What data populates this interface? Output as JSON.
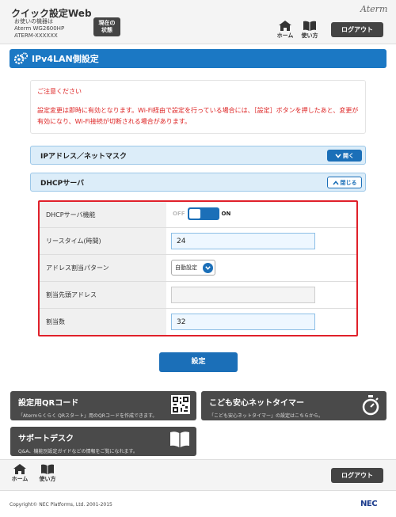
{
  "header": {
    "app_title": "クイック設定Web",
    "device_label": "お使いの機器は",
    "device_model": "Aterm WG2600HP",
    "device_id": "ATERM-XXXXXX",
    "current_status_line1": "現在の",
    "current_status_line2": "状態",
    "brand": "Aterm",
    "home_label": "ホーム",
    "help_label": "使い方",
    "logout_label": "ログアウト"
  },
  "page": {
    "title": "IPv4LAN側設定"
  },
  "notice": {
    "title": "ご注意ください",
    "body": "設定変更は即時に有効となります。Wi-Fi経由で設定を行っている場合には、［設定］ボタンを押したあと、変更が有効になり、Wi-Fi接続が切断される場合があります。"
  },
  "sections": {
    "ip_mask": {
      "label": "IPアドレス／ネットマスク",
      "button": "開く"
    },
    "dhcp": {
      "label": "DHCPサーバ",
      "button": "閉じる"
    }
  },
  "dhcp_settings": {
    "rows": [
      {
        "label": "DHCPサーバ機能",
        "off_label": "OFF",
        "on_label": "ON"
      },
      {
        "label": "リースタイム(時間)",
        "value": "24"
      },
      {
        "label": "アドレス割当パターン",
        "value": "自動設定"
      },
      {
        "label": "割当先頭アドレス",
        "value": ""
      },
      {
        "label": "割当数",
        "value": "32"
      }
    ]
  },
  "apply_label": "設定",
  "shortcuts": {
    "qr": {
      "title": "設定用QRコード",
      "desc": "「Atermらくらく QRスタート」用のQRコードを作成できます。"
    },
    "timer": {
      "title": "こども安心ネットタイマー",
      "desc": "「こども安心ネットタイマー」の設定はこちらから。"
    },
    "support": {
      "title": "サポートデスク",
      "desc": "Q&A、機能別設定ガイドなどの情報をご覧になれます。"
    }
  },
  "footer": {
    "home_label": "ホーム",
    "help_label": "使い方",
    "logout_label": "ログアウト",
    "copyright": "Copyright© NEC Platforms, Ltd. 2001-2015",
    "company_logo": "NEC"
  },
  "colors": {
    "accent": "#1b6fb8",
    "alert": "#e0202a",
    "dark_button": "#444444"
  }
}
